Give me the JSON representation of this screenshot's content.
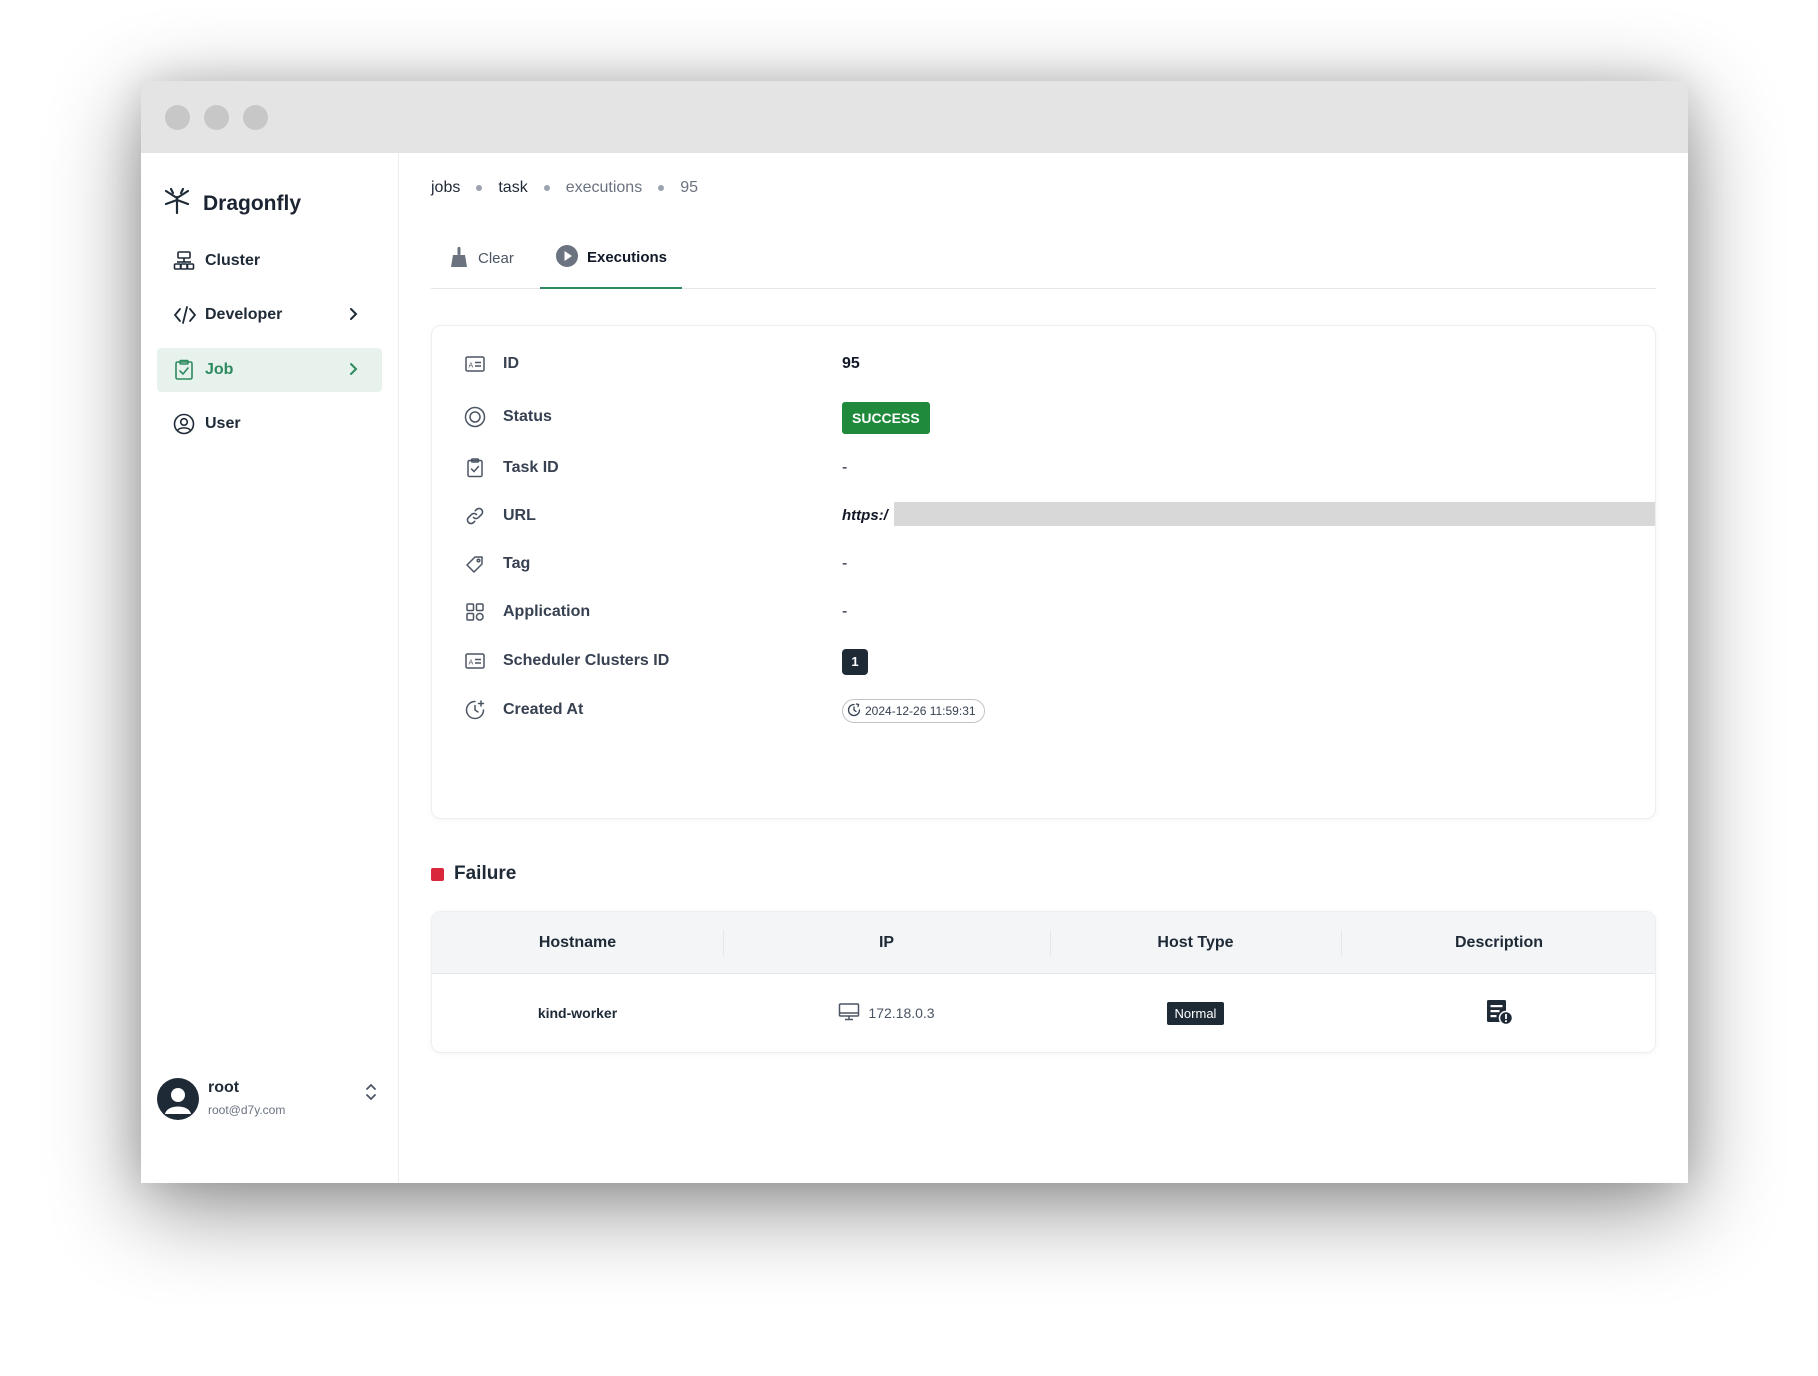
{
  "app": {
    "name": "Dragonfly"
  },
  "sidebar": {
    "items": [
      {
        "label": "Cluster",
        "icon": "cluster-icon"
      },
      {
        "label": "Developer",
        "icon": "code-icon"
      },
      {
        "label": "Job",
        "icon": "clipboard-check-icon",
        "active": true
      },
      {
        "label": "User",
        "icon": "user-circle-icon"
      }
    ]
  },
  "user": {
    "name": "root",
    "email": "root@d7y.com"
  },
  "breadcrumb": [
    "jobs",
    "task",
    "executions",
    "95"
  ],
  "tabs": [
    {
      "label": "Clear",
      "icon": "broom-icon"
    },
    {
      "label": "Executions",
      "icon": "play-circle-icon",
      "active": true
    }
  ],
  "details": {
    "id": {
      "label": "ID",
      "value": "95"
    },
    "status": {
      "label": "Status",
      "value": "SUCCESS"
    },
    "task_id": {
      "label": "Task ID",
      "value": "-"
    },
    "url": {
      "label": "URL",
      "value": "https:/"
    },
    "tag": {
      "label": "Tag",
      "value": "-"
    },
    "application": {
      "label": "Application",
      "value": "-"
    },
    "scheduler_clusters_id": {
      "label": "Scheduler Clusters ID",
      "value": "1"
    },
    "created_at": {
      "label": "Created At",
      "value": "2024-12-26 11:59:31"
    }
  },
  "failure": {
    "title": "Failure",
    "columns": [
      "Hostname",
      "IP",
      "Host Type",
      "Description"
    ],
    "rows": [
      {
        "hostname": "kind-worker",
        "ip": "172.18.0.3",
        "host_type": "Normal",
        "description_icon": "error-log-icon"
      }
    ]
  },
  "colors": {
    "accent": "#2e8a5f",
    "success": "#1f8a3b",
    "failure": "#d9263b",
    "dark": "#1f2a37"
  }
}
